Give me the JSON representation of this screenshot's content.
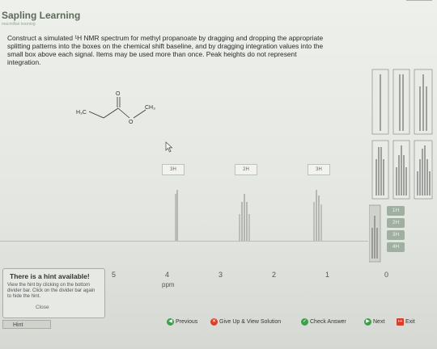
{
  "app": {
    "brand": "Sapling Learning",
    "brand_sub": "macmillan learning"
  },
  "question": {
    "lines": [
      "Construct a simulated ¹H NMR spectrum for methyl propanoate by dragging and dropping the appropriate",
      "splitting patterns into the boxes on the chemical shift baseline, and by dragging integration values into the",
      "small box above each signal. Items may be used more than once. Peak heights do not represent",
      "integration."
    ]
  },
  "molecule": {
    "left_group": "H₃C",
    "right_group": "CH₃",
    "carbonyl_o": "O",
    "ester_o": "O"
  },
  "spectrum": {
    "integration_boxes": [
      "3H",
      "2H",
      "3H"
    ],
    "axis_ticks": [
      "5",
      "4",
      "3",
      "2",
      "1",
      "0"
    ],
    "axis_label": "ppm"
  },
  "palette": {
    "integration_values": [
      "1H",
      "2H",
      "3H",
      "4H"
    ]
  },
  "hint": {
    "title": "There is a hint available!",
    "body": "View the hint by clicking on the bottom divider bar. Click on the divider bar again to hide the hint.",
    "close": "Close",
    "tab_label": "Hint"
  },
  "navigation": {
    "previous": "Previous",
    "give_up": "Give Up & View Solution",
    "check": "Check Answer",
    "next": "Next",
    "exit": "Exit"
  },
  "colors": {
    "previous": "#3aa04a",
    "give_up": "#d8402a",
    "check": "#3aa04a",
    "next": "#3aa04a",
    "exit": "#d8402a"
  }
}
